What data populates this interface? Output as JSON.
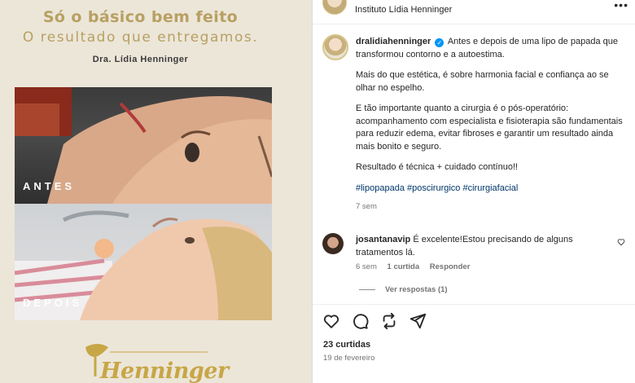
{
  "poster": {
    "headline": "Só o básico bem feito",
    "subheadline": "O resultado que entregamos.",
    "doctor": "Dra. Lídia Henninger",
    "before_label": "ANTES",
    "after_label": "DEPOIS",
    "logo_text": "Henninger"
  },
  "header": {
    "subtitle": "Instituto Lídia Henninger",
    "more_icon": "more-horizontal-icon"
  },
  "post": {
    "username": "dralidiahenninger",
    "paragraphs": [
      "Antes e depois de uma lipo de papada que transformou contorno e a autoestima.",
      "Mais do que estética, é sobre harmonia facial e confiança ao se olhar no espelho.",
      "E tão importante quanto a cirurgia é o pós-operatório: acompanhamento com especialista e fisioterapia são fundamentais para reduzir edema, evitar fibroses e garantir um resultado ainda mais bonito e seguro.",
      "Resultado é técnica + cuidado contínuo!!"
    ],
    "hashtags": "#lipopapada #poscirurgico #cirurgiafacial",
    "time": "7 sem"
  },
  "comment": {
    "username": "josantanavip",
    "text": "É excelente!Estou precisando de alguns tratamentos lá.",
    "time": "6 sem",
    "likes": "1 curtida",
    "reply": "Responder",
    "view_replies": "Ver respostas (1)"
  },
  "actions": {
    "likes": "23 curtidas",
    "date": "19 de fevereiro",
    "icons": [
      "heart-icon",
      "comment-icon",
      "repost-icon",
      "share-icon"
    ]
  },
  "colors": {
    "gold": "#b8a062",
    "link": "#00376b",
    "verified": "#0095f6",
    "muted": "#737373"
  }
}
